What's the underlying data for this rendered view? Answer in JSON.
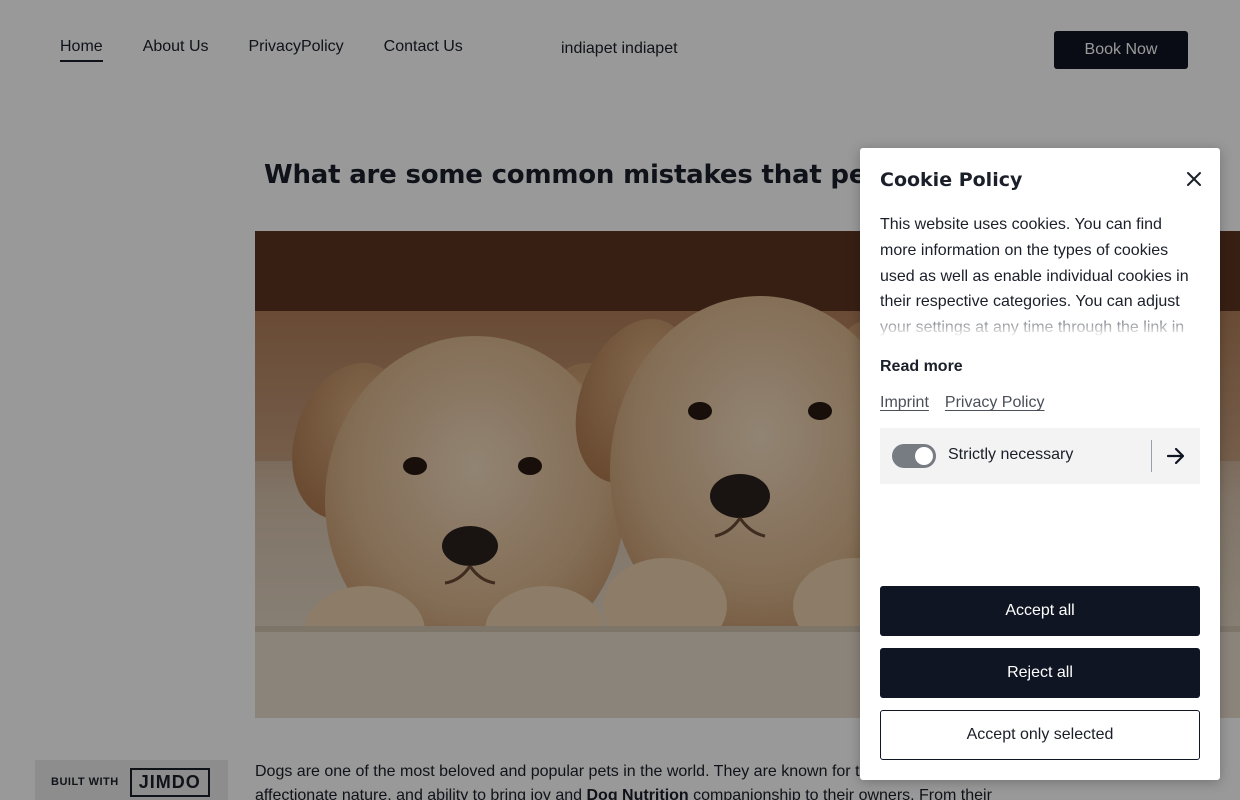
{
  "nav": {
    "items": [
      {
        "label": "Home",
        "active": true
      },
      {
        "label": "About Us",
        "active": false
      },
      {
        "label": "PrivacyPolicy",
        "active": false
      },
      {
        "label": "Contact Us",
        "active": false
      }
    ],
    "brand": "indiapet indiapet",
    "book_button": "Book Now"
  },
  "article": {
    "title": "What are some common mistakes that pet owne",
    "hero_image": "two golden retriever puppies resting paws on a ledge",
    "body_part1": "Dogs are one of the most beloved and popular pets in the world. They are known for th",
    "body_part2": "affectionate nature, and ability to bring joy and ",
    "body_bold": "Dog Nutrition",
    "body_part3": " companionship to their owners. From their"
  },
  "badge": {
    "built_with": "BUILT WITH",
    "logo": "JIMDO"
  },
  "cookie": {
    "title": "Cookie Policy",
    "description": "This website uses cookies. You can find more information on the types of cookies used as well as enable individual cookies in their respective categories. You can adjust your settings at any time through the link in the",
    "read_more": "Read more",
    "imprint_link": "Imprint",
    "privacy_link": "Privacy Policy",
    "category_label": "Strictly necessary",
    "category_enabled": true,
    "accept_all": "Accept all",
    "reject_all": "Reject all",
    "accept_selected": "Accept only selected"
  },
  "colors": {
    "primary_dark": "#0f1522",
    "overlay": "rgba(0,0,0,0.40)",
    "toggle_on": "#777b82"
  }
}
